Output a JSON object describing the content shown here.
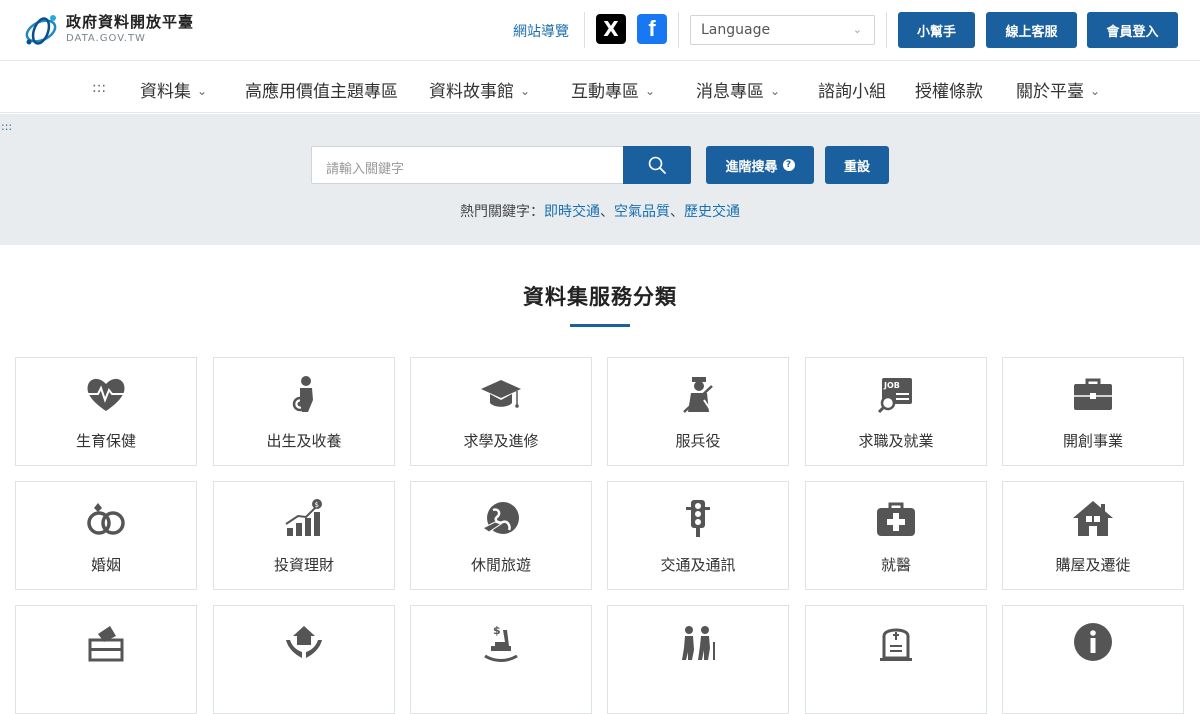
{
  "header": {
    "logo_title": "政府資料開放平臺",
    "logo_sub": "DATA.GOV.TW",
    "sitemap": "網站導覽",
    "social_x": "X",
    "social_fb": "f",
    "language_placeholder": "Language",
    "btn_helper": "小幫手",
    "btn_service": "線上客服",
    "btn_login": "會員登入"
  },
  "nav": {
    "dots": ":::",
    "items": [
      "資料集",
      "高應用價值主題專區",
      "資料故事館",
      "互動專區",
      "消息專區",
      "諮詢小組",
      "授權條款",
      "關於平臺"
    ]
  },
  "search": {
    "band_dots": ":::",
    "placeholder": "請輸入關鍵字",
    "advanced": "進階搜尋",
    "reset": "重設",
    "hot_label": "熱門關鍵字：",
    "hot_keywords": [
      "即時交通",
      "空氣品質",
      "歷史交通"
    ],
    "sep": "、"
  },
  "categories": {
    "title": "資料集服務分類",
    "items": [
      {
        "label": "生育保健",
        "icon": "heart-pulse-icon"
      },
      {
        "label": "出生及收養",
        "icon": "baby-care-icon"
      },
      {
        "label": "求學及進修",
        "icon": "graduation-cap-icon"
      },
      {
        "label": "服兵役",
        "icon": "soldier-icon"
      },
      {
        "label": "求職及就業",
        "icon": "job-search-icon"
      },
      {
        "label": "開創事業",
        "icon": "briefcase-icon"
      },
      {
        "label": "婚姻",
        "icon": "rings-icon"
      },
      {
        "label": "投資理財",
        "icon": "growth-chart-icon"
      },
      {
        "label": "休閒旅遊",
        "icon": "globe-plane-icon"
      },
      {
        "label": "交通及通訊",
        "icon": "traffic-light-icon"
      },
      {
        "label": "就醫",
        "icon": "medical-kit-icon"
      },
      {
        "label": "購屋及遷徙",
        "icon": "house-icon"
      },
      {
        "label": "",
        "icon": "ballot-box-icon"
      },
      {
        "label": "",
        "icon": "hands-house-icon"
      },
      {
        "label": "",
        "icon": "rocking-chair-icon"
      },
      {
        "label": "",
        "icon": "elderly-icon"
      },
      {
        "label": "",
        "icon": "tombstone-icon"
      },
      {
        "label": "",
        "icon": "info-icon"
      }
    ]
  },
  "colors": {
    "primary": "#1a5f9e",
    "link": "#1a6fb0",
    "band_bg": "#e9ecef",
    "icon_gray": "#555555"
  }
}
